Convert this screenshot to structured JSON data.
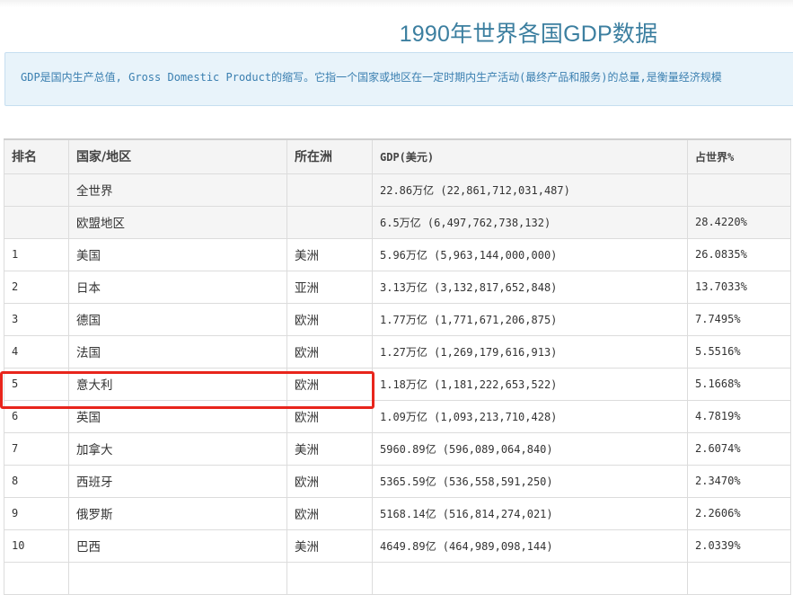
{
  "page": {
    "title": "1990年世界各国GDP数据",
    "intro": "GDP是国内生产总值, Gross Domestic Product的缩写。它指一个国家或地区在一定时期内生产活动(最终产品和服务)的总量,是衡量经济规模"
  },
  "table": {
    "headers": [
      "排名",
      "国家/地区",
      "所在洲",
      "GDP(美元)",
      "占世界%"
    ],
    "rows": [
      {
        "rank": "",
        "country": "全世界",
        "continent": "",
        "gdp": "22.86万亿 (22,861,712,031,487)",
        "share": ""
      },
      {
        "rank": "",
        "country": "欧盟地区",
        "continent": "",
        "gdp": "6.5万亿 (6,497,762,738,132)",
        "share": "28.4220%"
      },
      {
        "rank": "1",
        "country": "美国",
        "continent": "美洲",
        "gdp": "5.96万亿 (5,963,144,000,000)",
        "share": "26.0835%"
      },
      {
        "rank": "2",
        "country": "日本",
        "continent": "亚洲",
        "gdp": "3.13万亿 (3,132,817,652,848)",
        "share": "13.7033%"
      },
      {
        "rank": "3",
        "country": "德国",
        "continent": "欧洲",
        "gdp": "1.77万亿 (1,771,671,206,875)",
        "share": "7.7495%"
      },
      {
        "rank": "4",
        "country": "法国",
        "continent": "欧洲",
        "gdp": "1.27万亿 (1,269,179,616,913)",
        "share": "5.5516%"
      },
      {
        "rank": "5",
        "country": "意大利",
        "continent": "欧洲",
        "gdp": "1.18万亿 (1,181,222,653,522)",
        "share": "5.1668%"
      },
      {
        "rank": "6",
        "country": "英国",
        "continent": "欧洲",
        "gdp": "1.09万亿 (1,093,213,710,428)",
        "share": "4.7819%"
      },
      {
        "rank": "7",
        "country": "加拿大",
        "continent": "美洲",
        "gdp": "5960.89亿 (596,089,064,840)",
        "share": "2.6074%"
      },
      {
        "rank": "8",
        "country": "西班牙",
        "continent": "欧洲",
        "gdp": "5365.59亿 (536,558,591,250)",
        "share": "2.3470%"
      },
      {
        "rank": "9",
        "country": "俄罗斯",
        "continent": "欧洲",
        "gdp": "5168.14亿 (516,814,274,021)",
        "share": "2.2606%"
      },
      {
        "rank": "10",
        "country": "巴西",
        "continent": "美洲",
        "gdp": "4649.89亿 (464,989,098,144)",
        "share": "2.0339%"
      },
      {
        "rank": "",
        "country": "",
        "continent": "",
        "gdp": "",
        "share": ""
      }
    ]
  },
  "colors": {
    "title": "#3c7fa0",
    "intro_bg": "#e8f3fa",
    "highlight": "#e8251c"
  }
}
